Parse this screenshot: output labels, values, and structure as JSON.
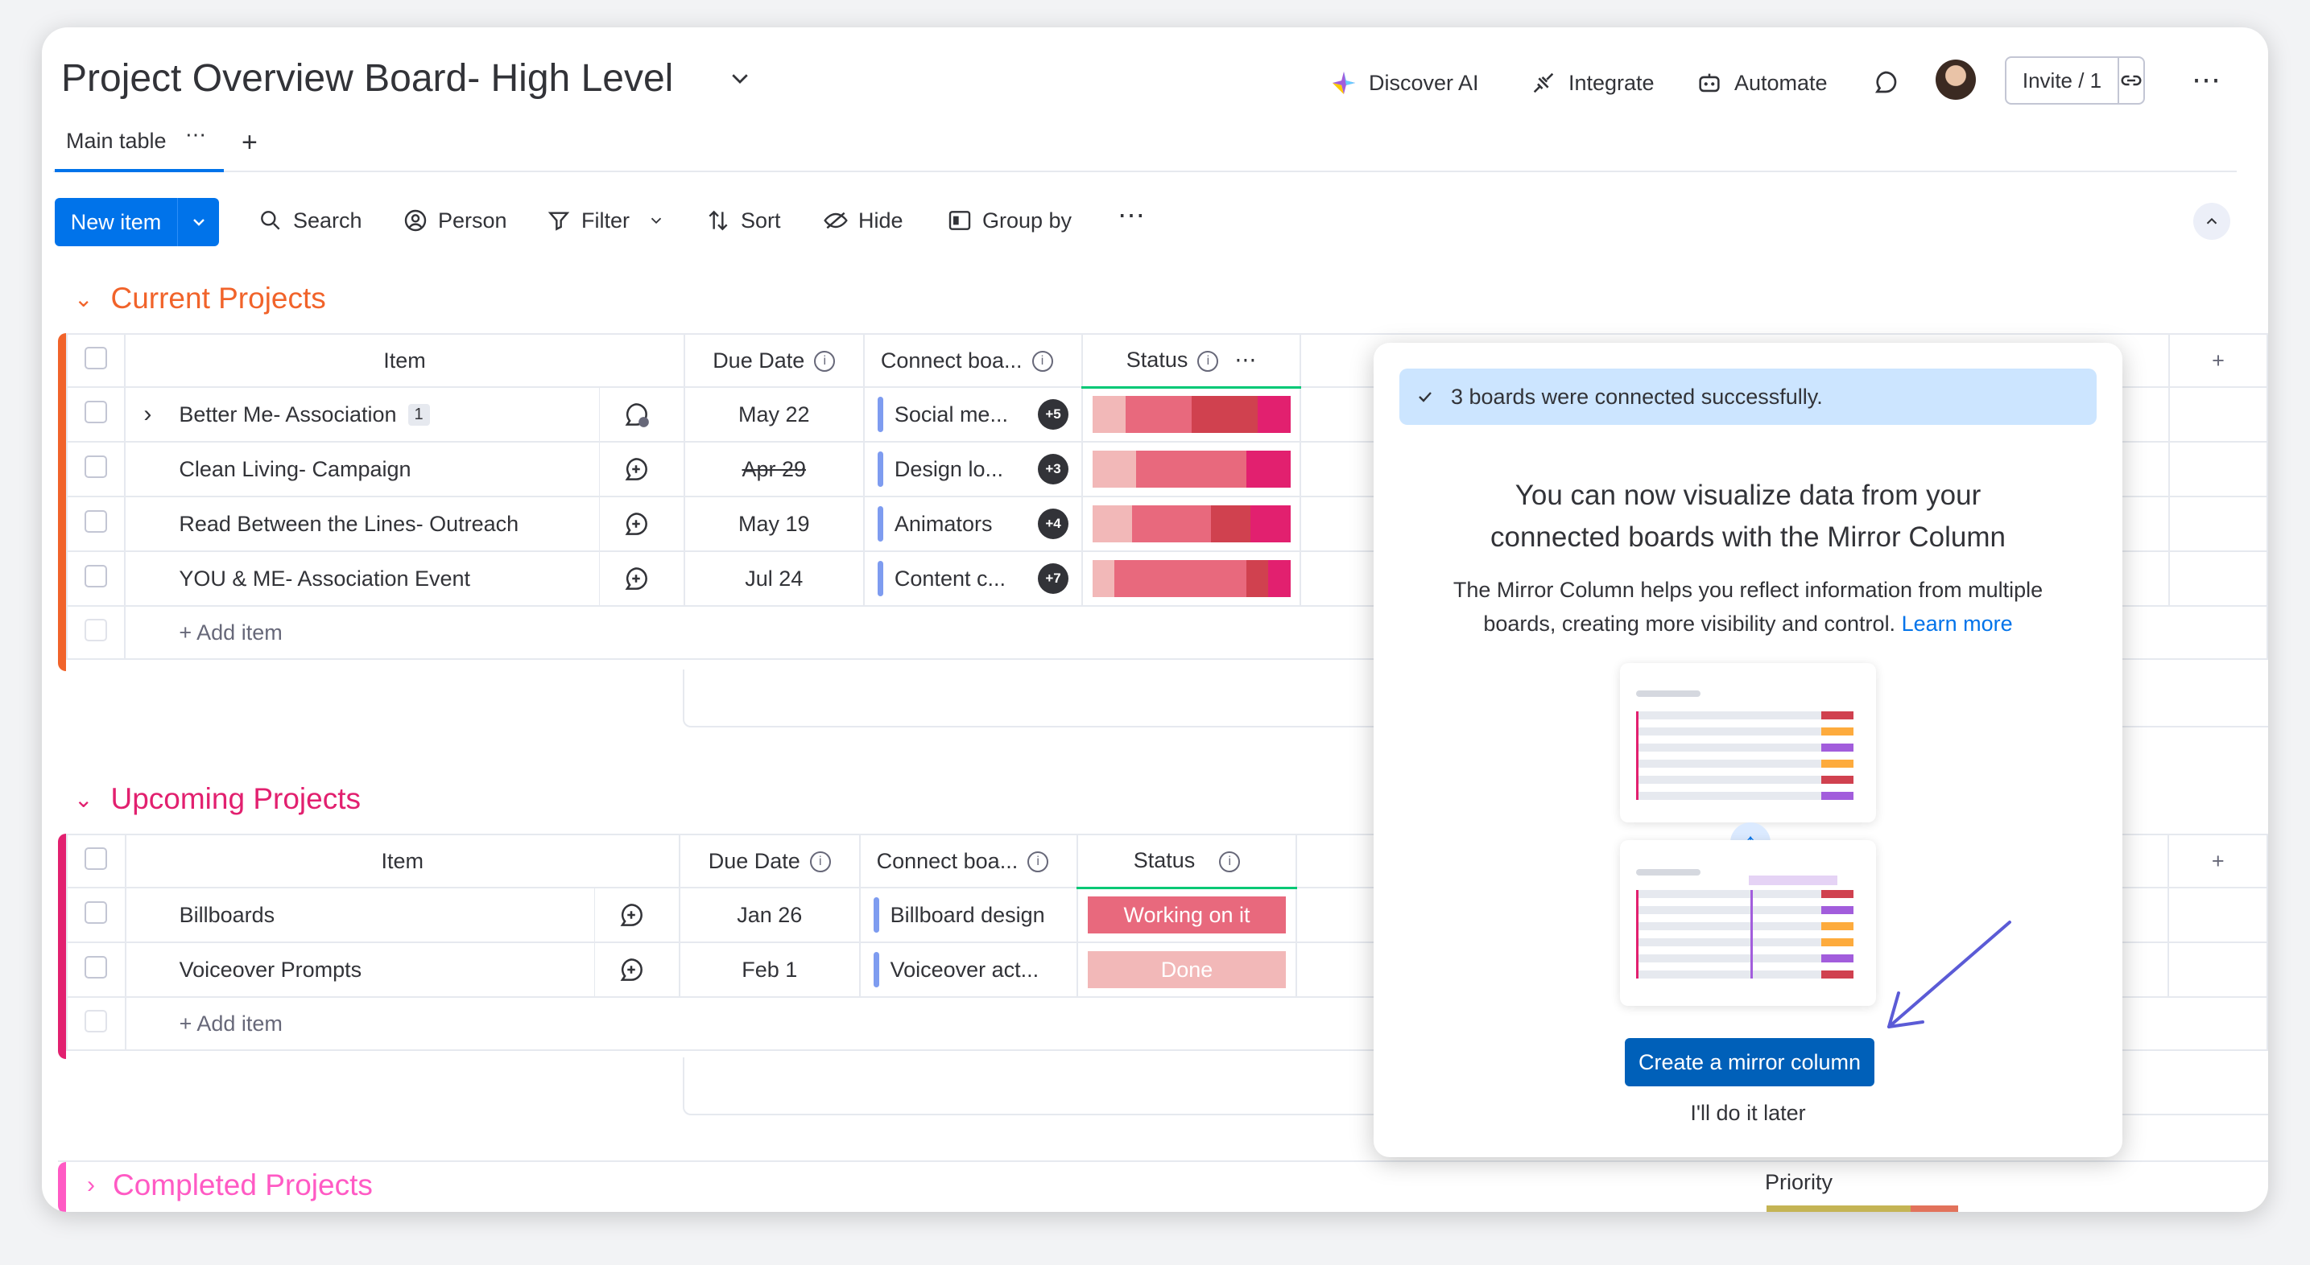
{
  "board": {
    "title": "Project Overview Board- High Level"
  },
  "topbar": {
    "discover_ai": "Discover AI",
    "integrate": "Integrate",
    "automate": "Automate",
    "invite": "Invite / 1"
  },
  "tabs": {
    "main_table": "Main table"
  },
  "toolbar": {
    "new_item": "New item",
    "search": "Search",
    "person": "Person",
    "filter": "Filter",
    "sort": "Sort",
    "hide": "Hide",
    "group_by": "Group by"
  },
  "columns": {
    "item": "Item",
    "due_date": "Due Date",
    "connect": "Connect boa...",
    "status": "Status",
    "priority": "Priority"
  },
  "groups": {
    "current": {
      "title": "Current Projects",
      "color": "#e2445c",
      "rows": [
        {
          "name": "Better Me- Association",
          "subitems": "1",
          "due": "May 22",
          "connect": "Social me...",
          "more": "+5"
        },
        {
          "name": "Clean Living- Campaign",
          "due": "Apr 29",
          "connect": "Design lo...",
          "more": "+3"
        },
        {
          "name": "Read Between the Lines- Outreach",
          "due": "May 19",
          "connect": "Animators",
          "more": "+4"
        },
        {
          "name": "YOU & ME- Association Event",
          "due": "Jul 24",
          "connect": "Content c...",
          "more": "+7"
        }
      ],
      "add_item": "+ Add item"
    },
    "upcoming": {
      "title": "Upcoming Projects",
      "rows": [
        {
          "name": "Billboards",
          "due": "Jan 26",
          "connect": "Billboard design",
          "status": "Working on it",
          "status_color": "#e8697d"
        },
        {
          "name": "Voiceover Prompts",
          "due": "Feb 1",
          "connect": "Voiceover act...",
          "status": "Done",
          "status_color": "#f2b8b8"
        }
      ],
      "add_item": "+ Add item"
    },
    "completed": {
      "title": "Completed Projects"
    }
  },
  "popup": {
    "toast": "3 boards were connected successfully.",
    "heading_line1": "You can now visualize data from your",
    "heading_line2": "connected boards with the Mirror Column",
    "body_line1": "The Mirror Column helps you reflect information from multiple",
    "body_line2": "boards, creating more visibility and control.",
    "learn_more": "Learn more",
    "cta": "Create a mirror column",
    "later": "I'll do it later"
  },
  "colors": {
    "current_group": "#f1632a",
    "upcoming_group": "#e2206f",
    "completed_group": "#ff5ac4",
    "primary": "#0073ea"
  }
}
